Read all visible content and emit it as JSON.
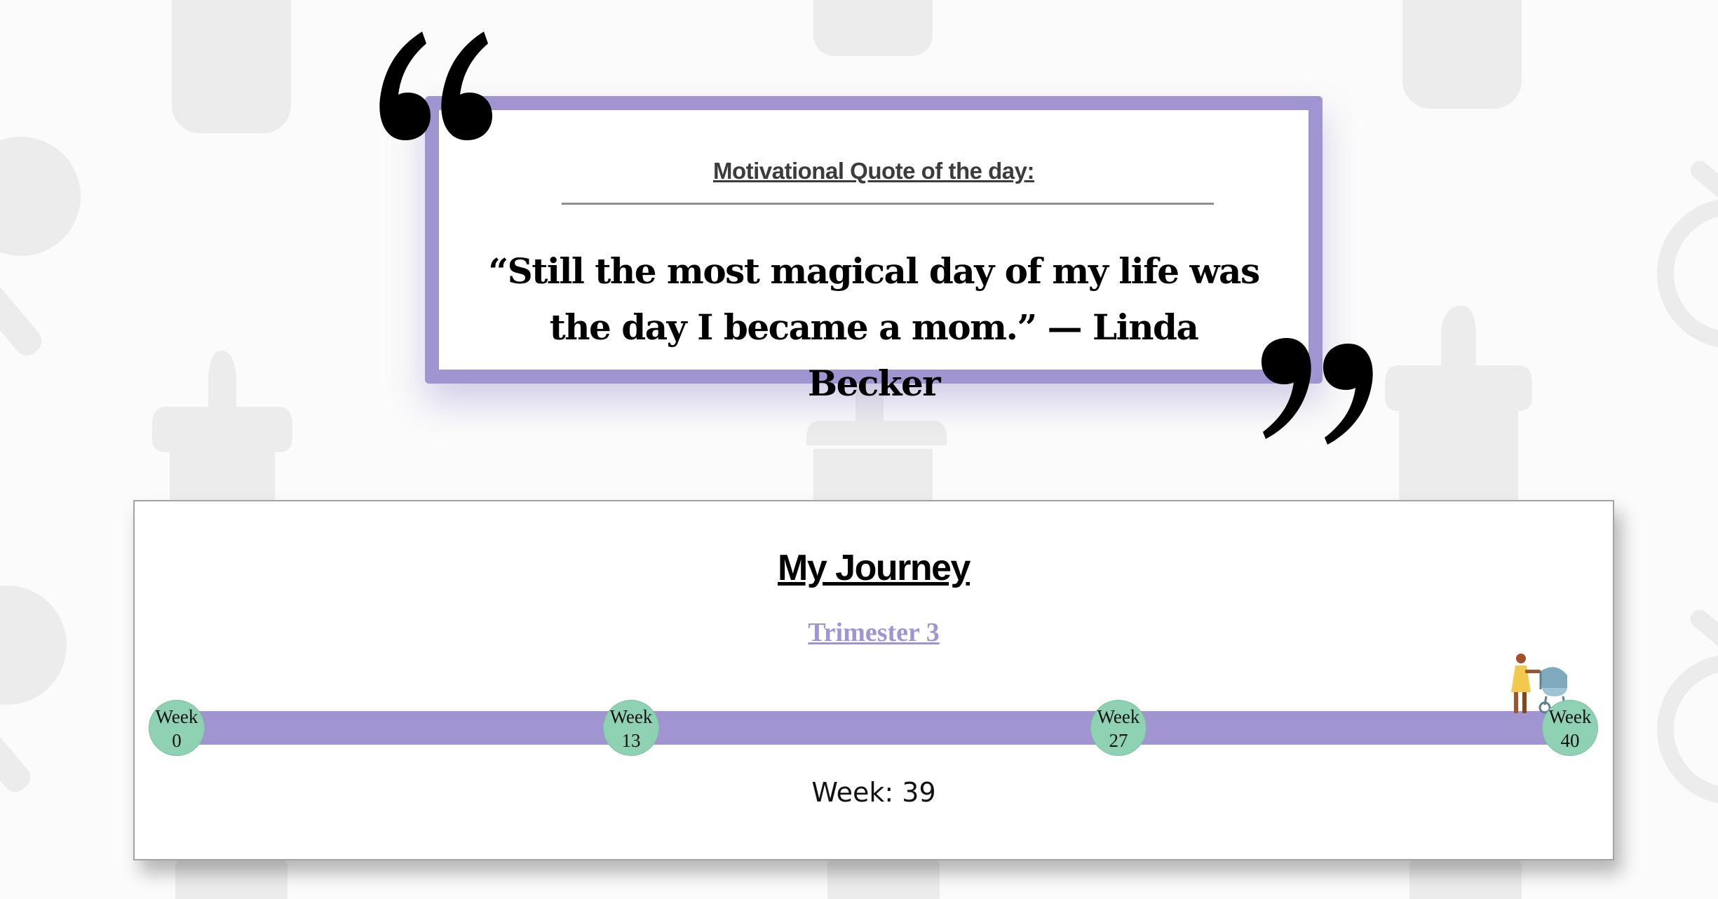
{
  "quote": {
    "heading": "Motivational Quote of the day:",
    "text": "“Still the most magical day of my life was the day I became a mom.” — Linda Becker"
  },
  "journey": {
    "title": "My Journey",
    "trimester": "Trimester 3",
    "milestones": [
      {
        "label": "Week",
        "week": "0"
      },
      {
        "label": "Week",
        "week": "13"
      },
      {
        "label": "Week",
        "week": "27"
      },
      {
        "label": "Week",
        "week": "40"
      }
    ],
    "current_week_text": "Week: 39",
    "progress_fraction": 0.975
  },
  "colors": {
    "accent": "#a095d1",
    "milestone": "#8fd1b3",
    "background": "#fbfbfb"
  },
  "icons": [
    "open-quote-icon",
    "close-quote-icon",
    "mother-stroller-icon",
    "baby-bottle-icon",
    "pacifier-icon"
  ]
}
